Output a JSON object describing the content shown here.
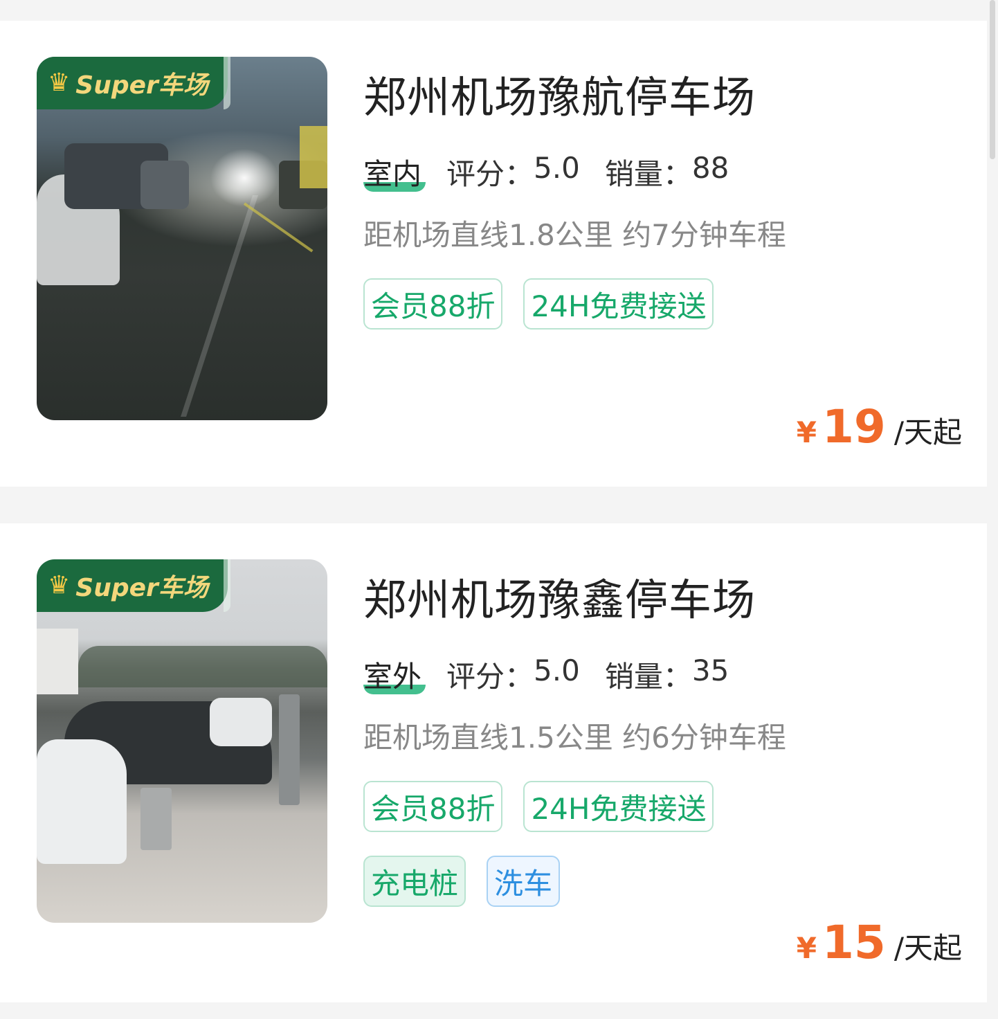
{
  "lots": [
    {
      "badge": "Super车场",
      "name": "郑州机场豫航停车场",
      "environment": "室内",
      "rating_label": "评分：",
      "rating": "5.0",
      "sales_label": "销量：",
      "sales": "88",
      "distance": "距机场直线1.8公里 约7分钟车程",
      "tags": [
        "会员88折",
        "24H免费接送"
      ],
      "currency": "¥",
      "price": "19",
      "price_unit": "/天起"
    },
    {
      "badge": "Super车场",
      "name": "郑州机场豫鑫停车场",
      "environment": "室外",
      "rating_label": "评分：",
      "rating": "5.0",
      "sales_label": "销量：",
      "sales": "35",
      "distance": "距机场直线1.5公里 约6分钟车程",
      "tags": [
        "会员88折",
        "24H免费接送"
      ],
      "service_tags": [
        "充电桩",
        "洗车"
      ],
      "currency": "¥",
      "price": "15",
      "price_unit": "/天起"
    }
  ],
  "colors": {
    "accent_green": "#17a86a",
    "badge_green": "#1b6a3e",
    "price_orange": "#f06a2a",
    "service_blue": "#2d8fe0"
  }
}
